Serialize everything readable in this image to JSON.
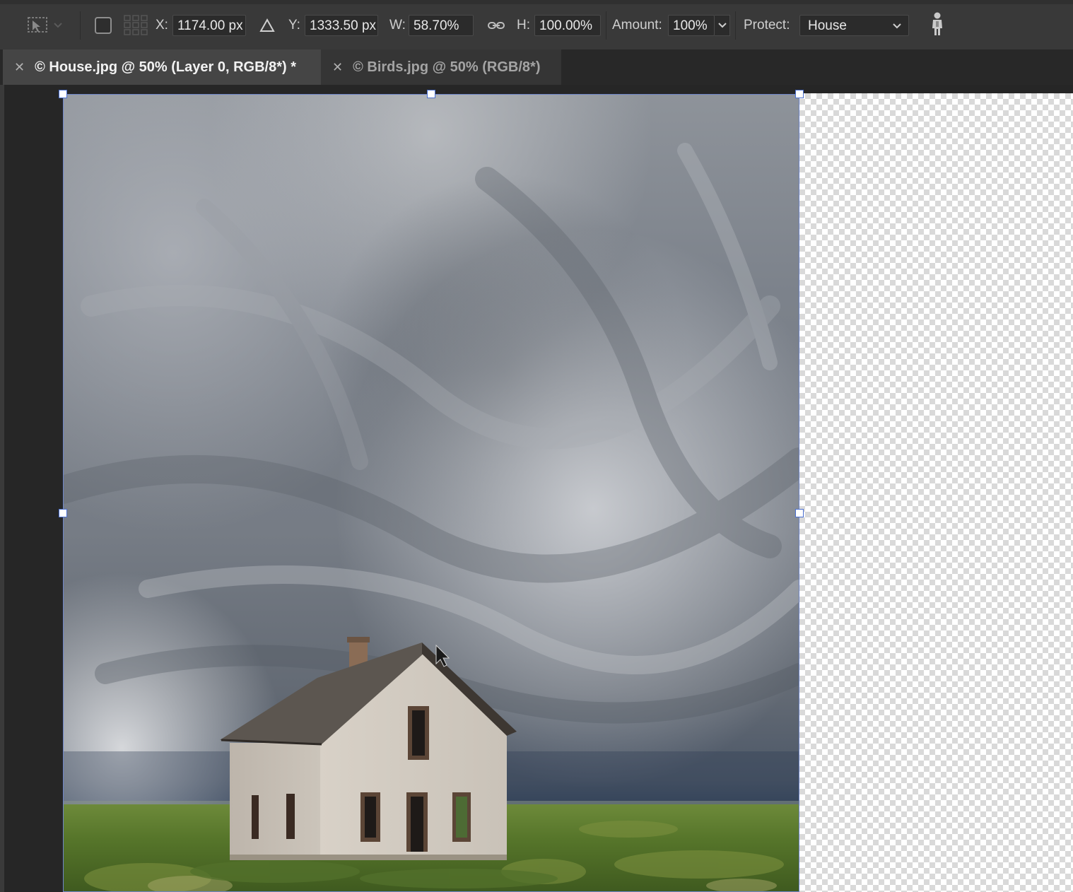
{
  "options_bar": {
    "x_label": "X:",
    "x_value": "1174.00 px",
    "y_label": "Y:",
    "y_value": "1333.50 px",
    "w_label": "W:",
    "w_value": "58.70%",
    "h_label": "H:",
    "h_value": "100.00%",
    "amount_label": "Amount:",
    "amount_value": "100%",
    "protect_label": "Protect:",
    "protect_value": "House"
  },
  "tabs": [
    {
      "label": "© House.jpg @ 50% (Layer 0, RGB/8*) *",
      "active": true
    },
    {
      "label": "© Birds.jpg @ 50% (RGB/8*)",
      "active": false
    }
  ],
  "colors": {
    "selection_handle_border": "#4a6fd0",
    "options_bar_bg": "#393939",
    "active_tab_bg": "#454545"
  },
  "icons": [
    "reference-point-icon",
    "reference-point-toggle-icon",
    "delta-icon",
    "link-icon",
    "skin-tone-person-icon",
    "close-icon",
    "mouse-cursor-icon"
  ]
}
